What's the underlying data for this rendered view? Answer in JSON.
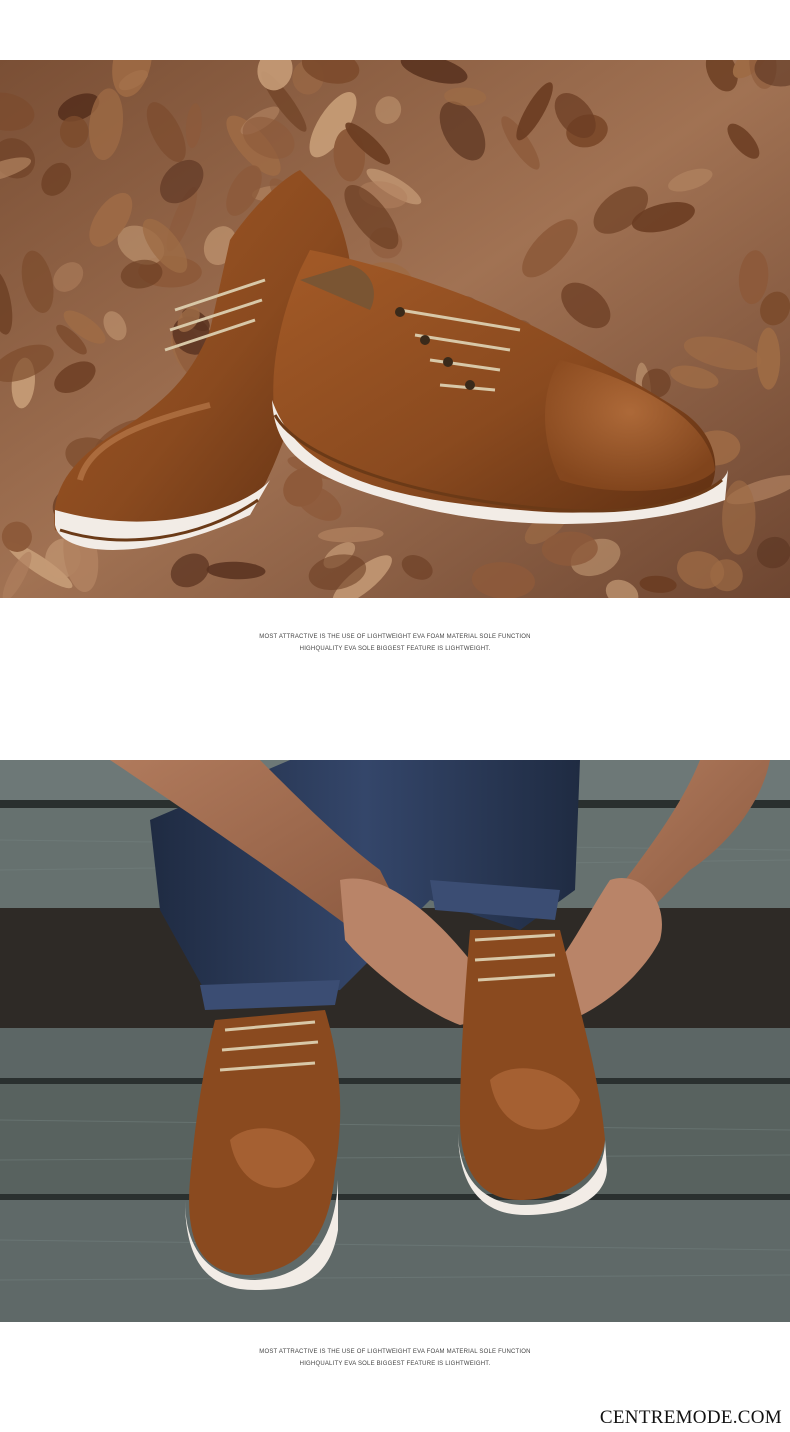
{
  "photos": [
    {
      "name": "shoes-on-autumn-leaves"
    },
    {
      "name": "man-tying-shoes-on-wooden-steps"
    }
  ],
  "captions": [
    {
      "line1": "MOST ATTRACTIVE IS THE USE OF LIGHTWEIGHT EVA FOAM MATERIAL SOLE FUNCTION",
      "line2": "HIGHQUALITY EVA SOLE BIGGEST FEATURE IS LIGHTWEIGHT."
    },
    {
      "line1": "MOST ATTRACTIVE IS THE USE OF LIGHTWEIGHT EVA FOAM MATERIAL SOLE FUNCTION",
      "line2": "HIGHQUALITY EVA SOLE BIGGEST FEATURE IS LIGHTWEIGHT."
    }
  ],
  "watermark": "CENTREMODE.COM",
  "colors": {
    "leather": "#8a4a1f",
    "leaves": "#9a6b4a",
    "wood": "#5c6a6a",
    "denim": "#27354f",
    "sole": "#f2ece6"
  }
}
